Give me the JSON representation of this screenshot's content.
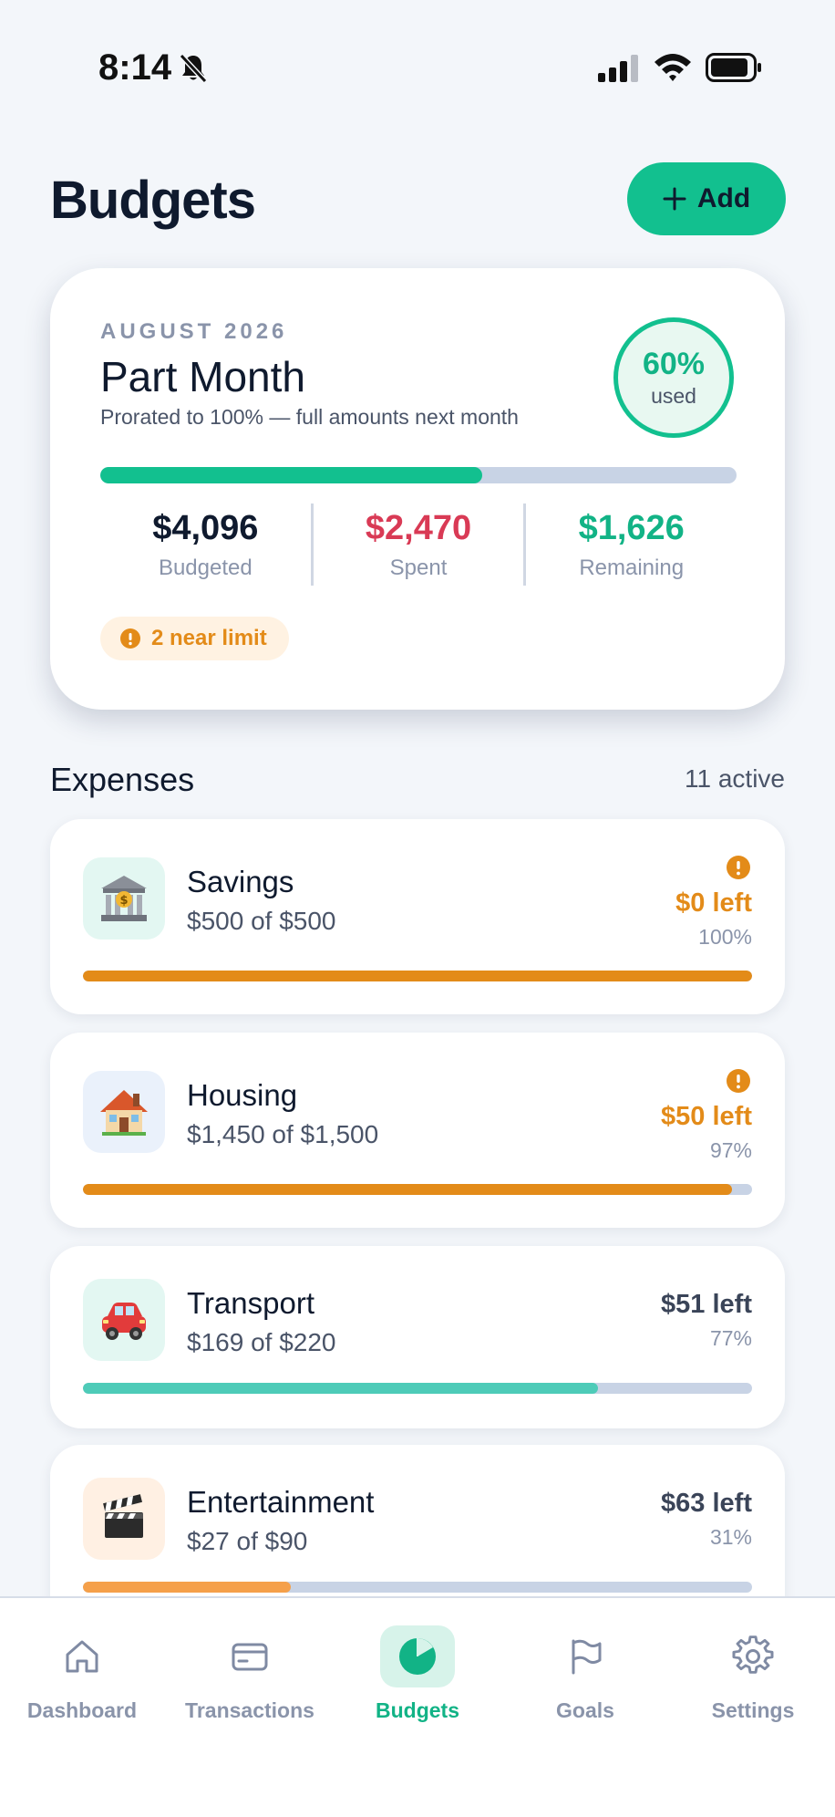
{
  "status_bar": {
    "time": "8:14"
  },
  "header": {
    "title": "Budgets",
    "add_label": "Add"
  },
  "summary": {
    "month": "AUGUST 2026",
    "title": "Part Month",
    "subtitle": "Prorated to 100% — full amounts next month",
    "used_pct": "60%",
    "used_label": "used",
    "progress": 0.6,
    "stats": [
      {
        "value": "$4,096",
        "label": "Budgeted"
      },
      {
        "value": "$2,470",
        "label": "Spent"
      },
      {
        "value": "$1,626",
        "label": "Remaining"
      }
    ],
    "near_limit": "2 near limit"
  },
  "expenses": {
    "title": "Expenses",
    "count": "11 active",
    "items": [
      {
        "name": "Savings",
        "amount": "$500 of $500",
        "left": "$0 left",
        "pct": "100%",
        "progress": 1.0,
        "emoji": "🏦",
        "warning": true
      },
      {
        "name": "Housing",
        "amount": "$1,450 of $1,500",
        "left": "$50 left",
        "pct": "97%",
        "progress": 0.97,
        "emoji": "🏠",
        "warning": true
      },
      {
        "name": "Transport",
        "amount": "$169 of $220",
        "left": "$51 left",
        "pct": "77%",
        "progress": 0.77,
        "emoji": "🚗",
        "warning": false
      },
      {
        "name": "Entertainment",
        "amount": "$27 of $90",
        "left": "$63 left",
        "pct": "31%",
        "progress": 0.31,
        "emoji": "🎬",
        "warning": false
      }
    ]
  },
  "nav": {
    "items": [
      {
        "label": "Dashboard",
        "icon": "home-icon"
      },
      {
        "label": "Transactions",
        "icon": "card-icon"
      },
      {
        "label": "Budgets",
        "icon": "pie-chart-icon",
        "active": true
      },
      {
        "label": "Goals",
        "icon": "flag-icon"
      },
      {
        "label": "Settings",
        "icon": "gear-icon"
      }
    ]
  },
  "colors": {
    "accent": "#12c08f",
    "warning": "#e38b19",
    "danger": "#d93a55",
    "transport_bar": "#4ecbb8",
    "entertainment_bar": "#f5a04a"
  }
}
